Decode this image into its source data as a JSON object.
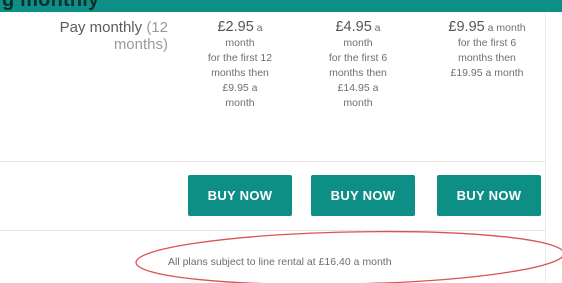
{
  "heading": "g   monthly",
  "row": {
    "label": "Pay monthly",
    "label_suffix": "(12",
    "label_line2": "months)"
  },
  "plans": [
    {
      "amount": "£2.95",
      "per": " a",
      "detail": [
        "month",
        "for the first 12",
        "months then",
        "£9.95 a",
        "month"
      ]
    },
    {
      "amount": "£4.95",
      "per": " a",
      "detail": [
        "month",
        "for the first 6",
        "months then",
        "£14.95 a",
        "month"
      ]
    },
    {
      "amount": "£9.95",
      "per": " a month",
      "detail": [
        "for the first 6",
        "months then",
        "£19.95 a month"
      ]
    }
  ],
  "buttons": {
    "buy_label": "BUY NOW"
  },
  "footnote": "All plans subject to line rental at £16.40 a month",
  "colors": {
    "accent": "#0d8f86",
    "annotation": "#d9534f"
  }
}
